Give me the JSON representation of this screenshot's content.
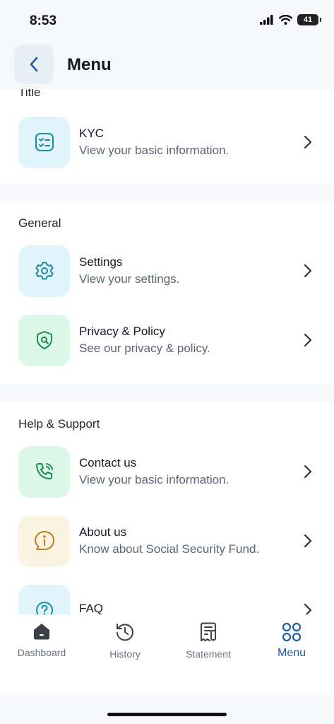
{
  "status": {
    "time": "8:53",
    "battery": "41"
  },
  "header": {
    "title": "Menu"
  },
  "sections": [
    {
      "title": "Title",
      "items": [
        {
          "title": "KYC",
          "subtitle": "View your basic information.",
          "icon": "list-check-icon",
          "bg": "#dff4fb",
          "stroke": "#1d8aa6"
        }
      ]
    },
    {
      "title": "General",
      "items": [
        {
          "title": "Settings",
          "subtitle": "View your settings.",
          "icon": "gear-icon",
          "bg": "#dff4fb",
          "stroke": "#1d8aa6"
        },
        {
          "title": "Privacy & Policy",
          "subtitle": "See our privacy & policy.",
          "icon": "shield-search-icon",
          "bg": "#dbf7e6",
          "stroke": "#1f8a55"
        }
      ]
    },
    {
      "title": "Help & Support",
      "items": [
        {
          "title": "Contact us",
          "subtitle": "View your basic information.",
          "icon": "phone-icon",
          "bg": "#dbf7e6",
          "stroke": "#1f8a55"
        },
        {
          "title": "About us",
          "subtitle": "Know about Social Security Fund.",
          "icon": "info-icon",
          "bg": "#fdf3e2",
          "stroke": "#b7821d"
        },
        {
          "title": "FAQ",
          "subtitle": "",
          "icon": "question-icon",
          "bg": "#dff4fb",
          "stroke": "#1d8aa6"
        }
      ]
    }
  ],
  "nav": [
    {
      "label": "Dashboard",
      "icon": "home-icon"
    },
    {
      "label": "History",
      "icon": "history-icon"
    },
    {
      "label": "Statement",
      "icon": "receipt-icon"
    },
    {
      "label": "Menu",
      "icon": "grid-icon",
      "active": true
    }
  ],
  "colors": {
    "accent": "#1f5fa3",
    "background": "#f6f8fb",
    "card": "#ffffff"
  }
}
